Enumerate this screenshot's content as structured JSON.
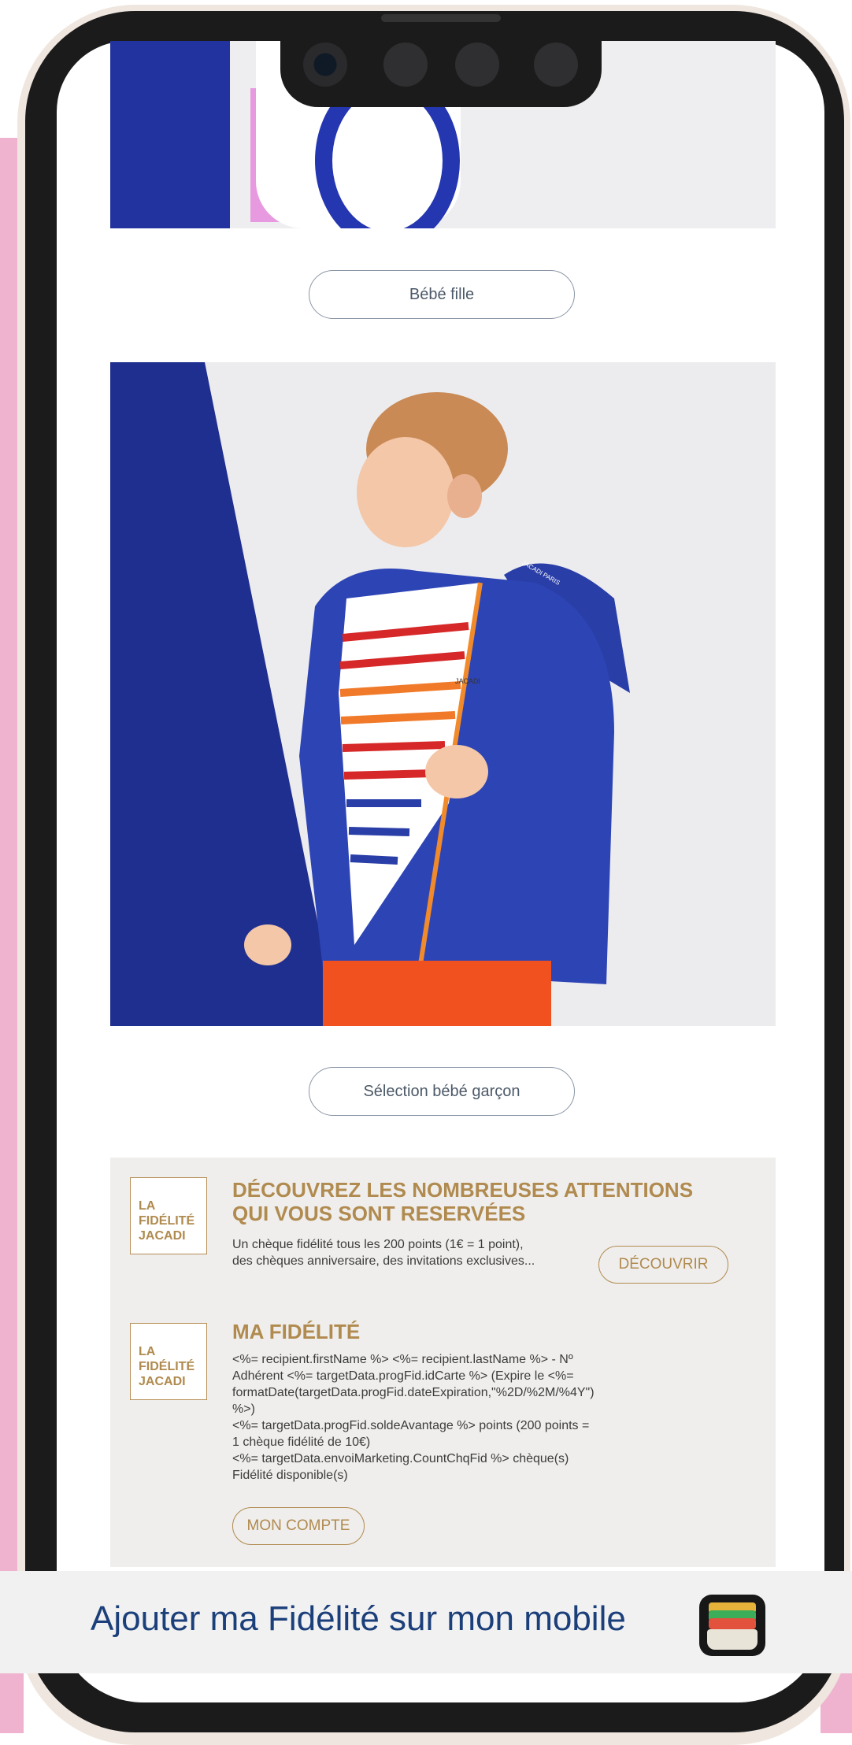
{
  "buttons": {
    "bebe_fille": "Bébé fille",
    "selection_garcon": "Sélection bébé garçon"
  },
  "loyalty": {
    "logo_lines": [
      "LA",
      "FIDÉLITÉ",
      "JACADI"
    ],
    "discover": {
      "title_line1": "DÉCOUVREZ LES NOMBREUSES ATTENTIONS",
      "title_line2": "QUI VOUS SONT RESERVÉES",
      "body_line1": "Un chèque fidélité tous les 200 points (1€ = 1 point),",
      "body_line2": "des chèques anniversaire, des invitations exclusives...",
      "button": "DÉCOUVRIR"
    },
    "account": {
      "title": "MA FIDÉLITÉ",
      "lines": [
        "<%= recipient.firstName %> <%= recipient.lastName %> - Nº",
        "Adhérent <%= targetData.progFid.idCarte %> (Expire le <%=",
        "formatDate(targetData.progFid.dateExpiration,\"%2D/%2M/%4Y\")",
        "%>)",
        "<%= targetData.progFid.soldeAvantage %> points (200 points =",
        "1 chèque fidélité de 10€)",
        "<%= targetData.envoiMarketing.CountChqFid %> chèque(s)",
        "Fidélité disponible(s)"
      ],
      "button": "MON COMPTE"
    }
  },
  "banner": {
    "text": "Ajouter ma Fidélité sur mon mobile",
    "icon": "wallet-icon"
  },
  "images": {
    "top": "baby-girl-dress-photo",
    "boy": "toddler-boy-blue-raincoat-photo",
    "jacket_label": "JACADI PARIS",
    "shirt_label": "JACADI"
  },
  "colors": {
    "gold": "#b08a4e",
    "navy_text": "#1b3f7a",
    "panel": "#efeeec",
    "pink": "#efb3cf",
    "frame": "#1c1b1b"
  }
}
